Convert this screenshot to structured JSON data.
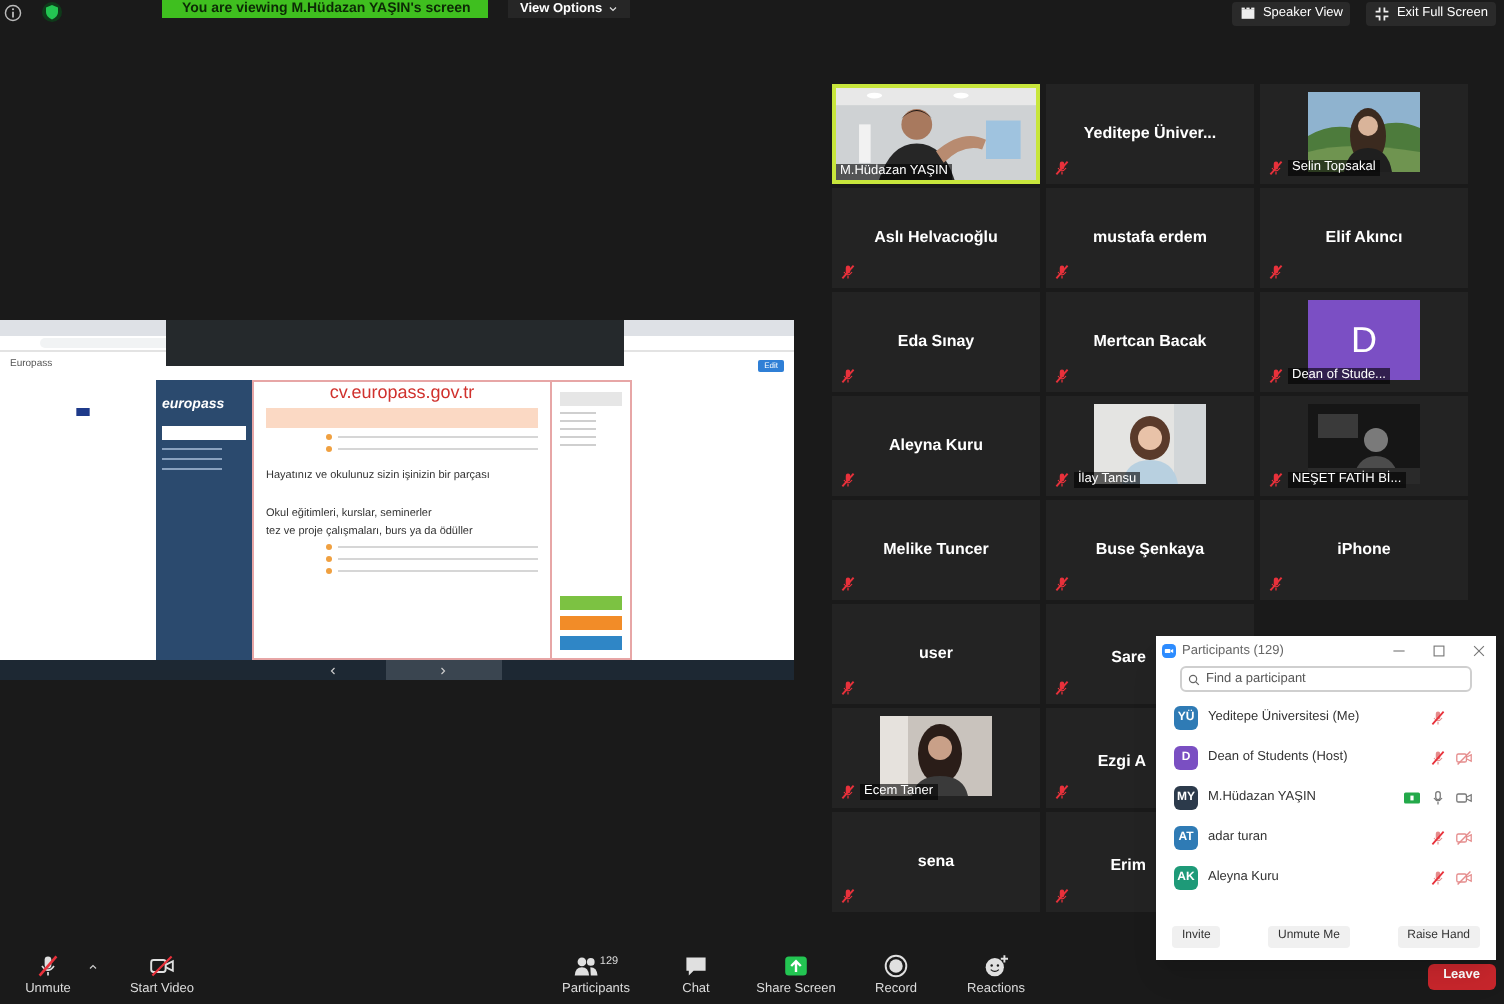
{
  "top_bar": {
    "viewing_banner": "You are viewing M.Hüdazan YAŞIN's screen",
    "view_options": "View Options",
    "speaker_view": "Speaker View",
    "exit_full_screen": "Exit Full Screen"
  },
  "shared_screen": {
    "page_title": "Europass",
    "edit_button": "Edit",
    "site_url": "cv.europass.gov.tr",
    "sidebar_logo": "europass",
    "overlay_notes": [
      "Hayatınız ve okulunuz sizin işinizin bir parçası",
      "Okul eğitimleri, kurslar, seminerler",
      "tez ve proje çalışmaları, burs ya da ödüller"
    ]
  },
  "gallery": {
    "rows": [
      [
        {
          "kind": "video",
          "name": "M.Hüdazan YAŞIN",
          "muted": false,
          "active_speaker": true
        },
        {
          "kind": "name",
          "name": "Yeditepe Üniver...",
          "muted": true,
          "active_speaker": false
        },
        {
          "kind": "video",
          "name": "Selin Topsakal",
          "muted": true,
          "active_speaker": false
        }
      ],
      [
        {
          "kind": "name",
          "name": "Aslı Helvacıoğlu",
          "muted": true,
          "active_speaker": false
        },
        {
          "kind": "name",
          "name": "mustafa erdem",
          "muted": true,
          "active_speaker": false
        },
        {
          "kind": "name",
          "name": "Elif Akıncı",
          "muted": true,
          "active_speaker": false
        }
      ],
      [
        {
          "kind": "name",
          "name": "Eda Sınay",
          "muted": true,
          "active_speaker": false
        },
        {
          "kind": "name",
          "name": "Mertcan Bacak",
          "muted": true,
          "active_speaker": false
        },
        {
          "kind": "avatar",
          "name": "Dean of Stude...",
          "initial": "D",
          "color": "#7b4fc4",
          "muted": true,
          "active_speaker": false
        }
      ],
      [
        {
          "kind": "name",
          "name": "Aleyna Kuru",
          "muted": true,
          "active_speaker": false
        },
        {
          "kind": "video",
          "name": "İlay Tansu",
          "muted": true,
          "active_speaker": false
        },
        {
          "kind": "video",
          "name": "NEŞET FATİH Bİ...",
          "muted": true,
          "active_speaker": false
        }
      ],
      [
        {
          "kind": "name",
          "name": "Melike Tuncer",
          "muted": true,
          "active_speaker": false
        },
        {
          "kind": "name",
          "name": "Buse Şenkaya",
          "muted": true,
          "active_speaker": false
        },
        {
          "kind": "name",
          "name": "iPhone",
          "muted": true,
          "active_speaker": false
        }
      ],
      [
        {
          "kind": "name",
          "name": "user",
          "muted": true,
          "active_speaker": false
        },
        {
          "kind": "name",
          "name": "Sare",
          "muted": true,
          "active_speaker": false
        }
      ],
      [
        {
          "kind": "video",
          "name": "Ecem Taner",
          "muted": true,
          "active_speaker": false
        },
        {
          "kind": "name",
          "name": "Ezgi A",
          "muted": true,
          "active_speaker": false
        }
      ],
      [
        {
          "kind": "name",
          "name": "sena",
          "muted": true,
          "active_speaker": false
        },
        {
          "kind": "name",
          "name": "Erim",
          "muted": true,
          "active_speaker": false
        }
      ]
    ]
  },
  "participants_panel": {
    "title": "Participants (129)",
    "search": {
      "placeholder": "Find a participant"
    },
    "participants": [
      {
        "initials": "YÜ",
        "color": "#2f7bb5",
        "name": "Yeditepe Üniversitesi (Me)",
        "mic_muted": true,
        "sharing": false
      },
      {
        "initials": "D",
        "color": "#7a4fc2",
        "name": "Dean of Students (Host)",
        "mic_muted": true,
        "video_off": true,
        "sharing": false
      },
      {
        "initials": "MY",
        "color": "#2c3a4b",
        "name": "M.Hüdazan YAŞIN",
        "mic_muted": false,
        "video_off": false,
        "sharing": true
      },
      {
        "initials": "AT",
        "color": "#2f7bb5",
        "name": "adar turan",
        "mic_muted": true,
        "video_off": true,
        "sharing": false
      },
      {
        "initials": "AK",
        "color": "#1e9a78",
        "name": "Aleyna Kuru",
        "mic_muted": true,
        "video_off": true,
        "sharing": false
      }
    ],
    "buttons": [
      "Invite",
      "Unmute Me",
      "Raise Hand"
    ]
  },
  "toolbar": {
    "items": [
      {
        "kind": "unmute",
        "label": "Unmute"
      },
      {
        "kind": "video",
        "label": "Start Video"
      },
      {
        "kind": "participants",
        "label": "Participants",
        "count": "129"
      },
      {
        "kind": "chat",
        "label": "Chat"
      },
      {
        "kind": "share",
        "label": "Share Screen"
      },
      {
        "kind": "record",
        "label": "Record"
      },
      {
        "kind": "reactions",
        "label": "Reactions"
      }
    ],
    "leave": "Leave"
  }
}
